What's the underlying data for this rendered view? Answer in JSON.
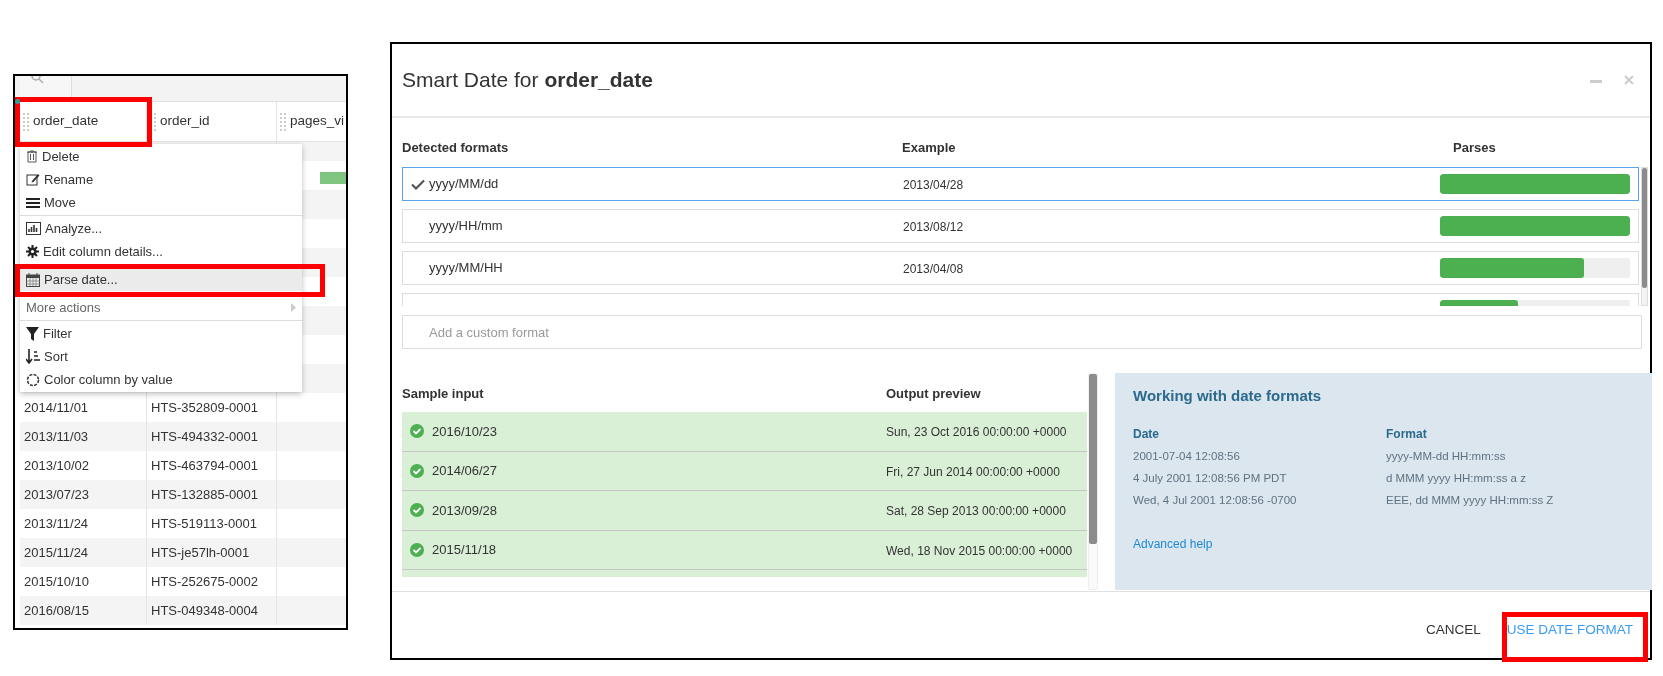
{
  "table": {
    "columns": [
      "order_date",
      "order_id",
      "pages_vi"
    ],
    "rows": [
      [
        "2014/11/01",
        "HTS-352809-0001"
      ],
      [
        "2013/11/03",
        "HTS-494332-0001"
      ],
      [
        "2013/10/02",
        "HTS-463794-0001"
      ],
      [
        "2013/07/23",
        "HTS-132885-0001"
      ],
      [
        "2013/11/24",
        "HTS-519113-0001"
      ],
      [
        "2015/11/24",
        "HTS-je57lh-0001"
      ],
      [
        "2015/10/10",
        "HTS-252675-0002"
      ],
      [
        "2016/08/15",
        "HTS-049348-0004"
      ]
    ]
  },
  "context_menu": {
    "groups": [
      [
        {
          "label": "Delete",
          "kind": "action",
          "selected": false
        },
        {
          "label": "Rename",
          "kind": "action",
          "selected": false
        },
        {
          "label": "Move",
          "kind": "action",
          "selected": false
        }
      ],
      [
        {
          "label": "Analyze...",
          "kind": "action",
          "selected": false
        },
        {
          "label": "Edit column details...",
          "kind": "action",
          "selected": false
        },
        {
          "label": "Parse date...",
          "kind": "action",
          "selected": true
        },
        {
          "label": "More actions",
          "kind": "submenu",
          "selected": false
        }
      ],
      [
        {
          "label": "Filter",
          "kind": "action",
          "selected": false
        },
        {
          "label": "Sort",
          "kind": "action",
          "selected": false
        },
        {
          "label": "Color column by value",
          "kind": "action",
          "selected": false
        }
      ]
    ]
  },
  "dialog": {
    "title": "Smart Date for **order_date**",
    "format_columns": [
      "Detected formats",
      "Example",
      "Parses"
    ],
    "formats": [
      {
        "format": "yyyy/MM/dd",
        "example": "2013/04/28",
        "level": 1,
        "selected": true
      },
      {
        "format": "yyyy/HH/mm",
        "example": "2013/08/12",
        "level": 1,
        "selected": false
      },
      {
        "format": "yyyy/MM/HH",
        "example": "2013/04/08",
        "level": 0.76,
        "selected": false
      },
      {
        "level": 0.41,
        "selected": false
      }
    ],
    "custom_format": {
      "placeholder": "Add a custom format"
    },
    "sample_columns": [
      "Sample input",
      "Output preview"
    ],
    "samples": [
      {
        "input": "2016/10/23",
        "output": "Sun, 23 Oct 2016 00:00:00 +0000",
        "valid": true
      },
      {
        "input": "2014/06/27",
        "output": "Fri, 27 Jun 2014 00:00:00 +0000",
        "valid": true
      },
      {
        "input": "2013/09/28",
        "output": "Sat, 28 Sep 2013 00:00:00 +0000",
        "valid": true
      },
      {
        "input": "2015/11/18",
        "output": "Wed, 18 Nov 2015 00:00:00 +0000",
        "valid": true
      },
      {
        "valid": true
      }
    ],
    "help": {
      "title": "Working with date formats",
      "columns": [
        "Date",
        "Format"
      ],
      "rows": [
        [
          "2001-07-04 12:08:56",
          "yyyy-MM-dd HH:mm:ss"
        ],
        [
          "4 July 2001 12:08:56 PM PDT",
          "d MMM yyyy HH:mm:ss a z"
        ],
        [
          "Wed, 4 Jul 2001 12:08:56 -0700",
          "EEE, dd MMM yyyy HH:mm:ss Z"
        ]
      ],
      "link": "Advanced help"
    },
    "buttons": [
      {
        "label": "CANCEL",
        "kind": "secondary"
      },
      {
        "label": "USE DATE FORMAT",
        "kind": "primary"
      }
    ]
  }
}
